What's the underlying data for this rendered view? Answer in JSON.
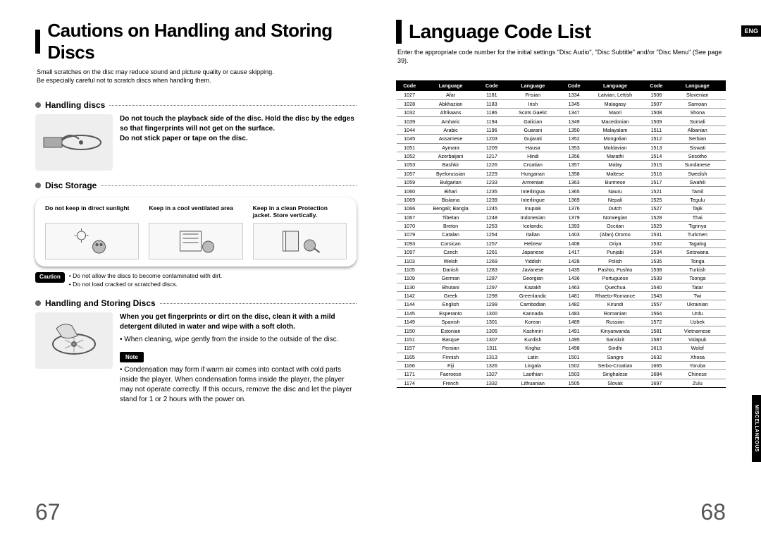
{
  "left": {
    "title": "Cautions on Handling and Storing Discs",
    "intro1": "Small scratches on the disc may reduce sound and picture quality or cause skipping.",
    "intro2": "Be especially careful not to scratch discs when handling them.",
    "sec1_title": "Handling discs",
    "sec1_b1": "Do not touch the playback side of the disc. Hold the disc by the edges so that fingerprints will not get on the surface.",
    "sec1_b2": "Do not stick paper or tape on the disc.",
    "sec2_title": "Disc Storage",
    "storage1": "Do not keep in direct sunlight",
    "storage2": "Keep in a cool ventilated area",
    "storage3": "Keep in a clean Protection jacket. Store vertically.",
    "caution_label": "Caution",
    "caution1": "Do not allow the discs to become contaminated with dirt.",
    "caution2": "Do not load cracked or scratched discs.",
    "sec3_title": "Handling and Storing Discs",
    "sec3_b1": "When you get fingerprints or dirt on the disc, clean it with a mild detergent diluted in water and wipe with a soft cloth.",
    "sec3_b2": "When cleaning, wipe gently from the inside to the outside of the disc.",
    "note_label": "Note",
    "note1": "Condensation may form if warm air comes into contact with cold parts inside the player. When condensation forms inside the player, the player may not operate correctly. If this occurs, remove the disc and let the player stand for 1 or 2 hours with the power on.",
    "page_num": "67"
  },
  "right": {
    "title": "Language Code List",
    "intro": "Enter the appropriate code number for the initial settings \"Disc Audio\", \"Disc Subtitle\" and/or \"Disc Menu\" (See page 39).",
    "th_code": "Code",
    "th_lang": "Language",
    "side_tab": "MISCELLANEOUS",
    "eng_tab": "ENG",
    "page_num": "68",
    "rows": [
      [
        "1027",
        "Afar",
        "1181",
        "Frisian",
        "1334",
        "Latvian, Lettish",
        "1506",
        "Slovenian"
      ],
      [
        "1028",
        "Abkhazian",
        "1183",
        "Irish",
        "1345",
        "Malagasy",
        "1507",
        "Samoan"
      ],
      [
        "1032",
        "Afrikaans",
        "1186",
        "Scots Gaelic",
        "1347",
        "Maori",
        "1508",
        "Shona"
      ],
      [
        "1039",
        "Amharic",
        "1194",
        "Galician",
        "1349",
        "Macedonian",
        "1509",
        "Somali"
      ],
      [
        "1044",
        "Arabic",
        "1196",
        "Guarani",
        "1350",
        "Malayalam",
        "1511",
        "Albanian"
      ],
      [
        "1045",
        "Assamese",
        "1203",
        "Gujarati",
        "1352",
        "Mongolian",
        "1512",
        "Serbian"
      ],
      [
        "1051",
        "Aymara",
        "1209",
        "Hausa",
        "1353",
        "Moldavian",
        "1513",
        "Siswati"
      ],
      [
        "1052",
        "Azerbaijani",
        "1217",
        "Hindi",
        "1356",
        "Marathi",
        "1514",
        "Sesotho"
      ],
      [
        "1053",
        "Bashkir",
        "1226",
        "Croatian",
        "1357",
        "Malay",
        "1515",
        "Sundanese"
      ],
      [
        "1057",
        "Byelorussian",
        "1229",
        "Hungarian",
        "1358",
        "Maltese",
        "1516",
        "Swedish"
      ],
      [
        "1059",
        "Bulgarian",
        "1233",
        "Armenian",
        "1363",
        "Burmese",
        "1517",
        "Swahili"
      ],
      [
        "1060",
        "Bihari",
        "1235",
        "Interlingua",
        "1365",
        "Nauru",
        "1521",
        "Tamil"
      ],
      [
        "1069",
        "Bislama",
        "1239",
        "Interlingue",
        "1369",
        "Nepali",
        "1525",
        "Tegulu"
      ],
      [
        "1066",
        "Bengali; Bangla",
        "1245",
        "Inupiak",
        "1376",
        "Dutch",
        "1527",
        "Tajik"
      ],
      [
        "1067",
        "Tibetan",
        "1248",
        "Indonesian",
        "1379",
        "Norwegian",
        "1528",
        "Thai"
      ],
      [
        "1070",
        "Breton",
        "1253",
        "Icelandic",
        "1393",
        "Occitan",
        "1529",
        "Tigrinya"
      ],
      [
        "1079",
        "Catalan",
        "1254",
        "Italian",
        "1403",
        "(Afan) Oromo",
        "1531",
        "Turkmen"
      ],
      [
        "1093",
        "Corsican",
        "1257",
        "Hebrew",
        "1408",
        "Oriya",
        "1532",
        "Tagalog"
      ],
      [
        "1097",
        "Czech",
        "1261",
        "Japanese",
        "1417",
        "Punjabi",
        "1534",
        "Setswana"
      ],
      [
        "1103",
        "Welsh",
        "1269",
        "Yiddish",
        "1428",
        "Polish",
        "1535",
        "Tonga"
      ],
      [
        "1105",
        "Danish",
        "1283",
        "Javanese",
        "1435",
        "Pashto, Pushto",
        "1538",
        "Turkish"
      ],
      [
        "1109",
        "German",
        "1287",
        "Georgian",
        "1436",
        "Portuguese",
        "1539",
        "Tsonga"
      ],
      [
        "1130",
        "Bhutani",
        "1297",
        "Kazakh",
        "1463",
        "Quechua",
        "1540",
        "Tatar"
      ],
      [
        "1142",
        "Greek",
        "1298",
        "Greenlandic",
        "1481",
        "Rhaeto-Romance",
        "1543",
        "Twi"
      ],
      [
        "1144",
        "English",
        "1299",
        "Cambodian",
        "1482",
        "Kirundi",
        "1557",
        "Ukrainian"
      ],
      [
        "1145",
        "Esperanto",
        "1300",
        "Kannada",
        "1483",
        "Romanian",
        "1564",
        "Urdu"
      ],
      [
        "1149",
        "Spanish",
        "1301",
        "Korean",
        "1489",
        "Russian",
        "1572",
        "Uzbek"
      ],
      [
        "1150",
        "Estonian",
        "1305",
        "Kashmiri",
        "1491",
        "Kinyarwanda",
        "1581",
        "Vietnamese"
      ],
      [
        "1151",
        "Basque",
        "1307",
        "Kurdish",
        "1495",
        "Sanskrit",
        "1587",
        "Volapuk"
      ],
      [
        "1157",
        "Persian",
        "1311",
        "Kirghiz",
        "1498",
        "Sindhi",
        "1613",
        "Wolof"
      ],
      [
        "1165",
        "Finnish",
        "1313",
        "Latin",
        "1501",
        "Sangro",
        "1632",
        "Xhosa"
      ],
      [
        "1166",
        "Fiji",
        "1326",
        "Lingala",
        "1502",
        "Serbo-Croatian",
        "1665",
        "Yoruba"
      ],
      [
        "1171",
        "Faeroese",
        "1327",
        "Laothian",
        "1503",
        "Singhalese",
        "1684",
        "Chinese"
      ],
      [
        "1174",
        "French",
        "1332",
        "Lithuanian",
        "1505",
        "Slovak",
        "1697",
        "Zulu"
      ]
    ]
  }
}
